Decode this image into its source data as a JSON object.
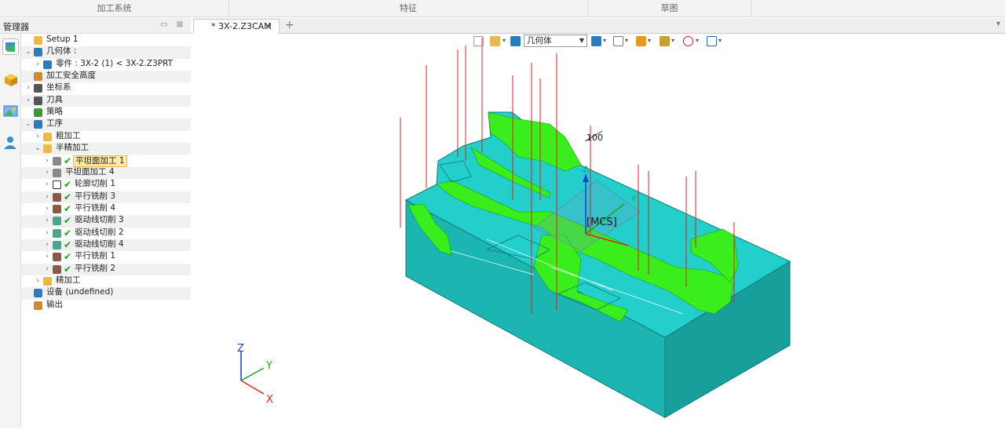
{
  "ribbon": {
    "tabs": [
      "加工系统",
      "特征",
      "草图"
    ]
  },
  "manager": {
    "title": "管理器",
    "tree": [
      {
        "label": "Setup 1",
        "level": 0,
        "caret": "",
        "icon": "setup-folder-icon",
        "icon_color": "#f0b83c",
        "checked": false
      },
      {
        "label": "几何体 :",
        "level": 0,
        "caret": "v",
        "icon": "geometry-icon",
        "icon_color": "#2b7bbf",
        "checked": false
      },
      {
        "label": "零件 : 3X-2 (1) < 3X-2.Z3PRT",
        "level": 1,
        "caret": ">",
        "icon": "part-icon",
        "icon_color": "#2b7bbf",
        "checked": false
      },
      {
        "label": "加工安全高度",
        "level": 0,
        "caret": "",
        "icon": "safe-height-icon",
        "icon_color": "#d18b2a",
        "checked": false
      },
      {
        "label": "坐标系",
        "level": 0,
        "caret": ">",
        "icon": "coordinate-icon",
        "icon_color": "#555555",
        "checked": false
      },
      {
        "label": "刀具",
        "level": 0,
        "caret": ">",
        "icon": "tool-icon",
        "icon_color": "#555555",
        "checked": false
      },
      {
        "label": "策略",
        "level": 0,
        "caret": "",
        "icon": "strategy-icon",
        "icon_color": "#3a9a3a",
        "checked": false
      },
      {
        "label": "工序",
        "level": 0,
        "caret": "v",
        "icon": "operation-icon",
        "icon_color": "#2b7bbf",
        "checked": false
      },
      {
        "label": "粗加工",
        "level": 1,
        "caret": ">",
        "icon": "folder-icon",
        "icon_color": "#f0b83c",
        "checked": false
      },
      {
        "label": "半精加工",
        "level": 1,
        "caret": "v",
        "icon": "folder-icon",
        "icon_color": "#f0b83c",
        "checked": false
      },
      {
        "label": "平坦面加工 1",
        "level": 2,
        "caret": ">",
        "icon": "flat-machining-icon",
        "icon_color": "#888888",
        "checked": true,
        "selected": true
      },
      {
        "label": "平坦面加工 4",
        "level": 2,
        "caret": ">",
        "icon": "flat-machining-icon",
        "icon_color": "#888888",
        "checked": false
      },
      {
        "label": "轮廓切削 1",
        "level": 2,
        "caret": ">",
        "icon": "contour-icon",
        "icon_color": "#ffffff",
        "checked": true
      },
      {
        "label": "平行铣削 3",
        "level": 2,
        "caret": ">",
        "icon": "parallel-milling-icon",
        "icon_color": "#8a5a44",
        "checked": true
      },
      {
        "label": "平行铣削 4",
        "level": 2,
        "caret": ">",
        "icon": "parallel-milling-icon",
        "icon_color": "#8a5a44",
        "checked": true
      },
      {
        "label": "驱动线切削 3",
        "level": 2,
        "caret": ">",
        "icon": "drive-curve-icon",
        "icon_color": "#4aa58a",
        "checked": true
      },
      {
        "label": "驱动线切削 2",
        "level": 2,
        "caret": ">",
        "icon": "drive-curve-icon",
        "icon_color": "#4aa58a",
        "checked": true
      },
      {
        "label": "驱动线切削 4",
        "level": 2,
        "caret": ">",
        "icon": "drive-curve-icon",
        "icon_color": "#4aa58a",
        "checked": true
      },
      {
        "label": "平行铣削 1",
        "level": 2,
        "caret": ">",
        "icon": "parallel-milling-icon",
        "icon_color": "#8a5a44",
        "checked": true
      },
      {
        "label": "平行铣削 2",
        "level": 2,
        "caret": ">",
        "icon": "parallel-milling-icon",
        "icon_color": "#8a5a44",
        "checked": true
      },
      {
        "label": "精加工",
        "level": 1,
        "caret": ">",
        "icon": "folder-icon",
        "icon_color": "#f0b83c",
        "checked": false
      },
      {
        "label": "设备 (undefined)",
        "level": 0,
        "caret": "",
        "icon": "machine-icon",
        "icon_color": "#2b7bbf",
        "checked": false
      },
      {
        "label": "输出",
        "level": 0,
        "caret": "",
        "icon": "output-icon",
        "icon_color": "#d18b2a",
        "checked": false
      }
    ]
  },
  "document": {
    "tab_label": "* 3X-2.Z3CAM"
  },
  "toolbar": {
    "geometry_select": "几何体"
  },
  "viewport": {
    "dimension_label": "100",
    "mcs_label": "[MCS]",
    "axis_x": "X",
    "axis_y": "Y",
    "axis_z": "Z"
  },
  "colors": {
    "model_cyan": "#1ecac6",
    "toolpath_green": "#39ee1c",
    "toolpath_red": "#e02020",
    "model_edge": "#0d7a78"
  }
}
